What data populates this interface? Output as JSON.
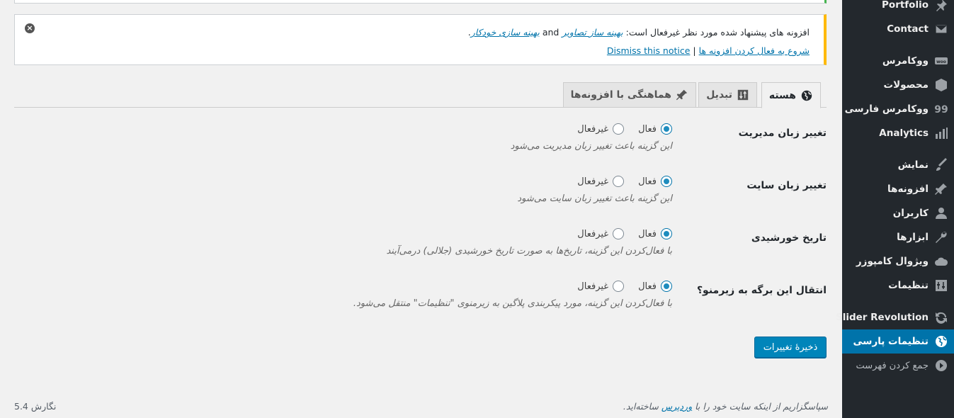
{
  "sidebar": {
    "items": [
      {
        "label": "Portfolio",
        "icon": "pin-icon"
      },
      {
        "label": "Contact",
        "icon": "mail-icon"
      },
      {
        "label": "ووکامرس",
        "icon": "woo-icon"
      },
      {
        "label": "محصولات",
        "icon": "box-icon"
      },
      {
        "label": "ووکامرس فارسی",
        "icon": "quote-icon"
      },
      {
        "label": "Analytics",
        "icon": "bar-chart-icon"
      },
      {
        "label": "نمایش",
        "icon": "brush-icon"
      },
      {
        "label": "افزونه‌ها",
        "icon": "plug-icon"
      },
      {
        "label": "کاربران",
        "icon": "user-icon"
      },
      {
        "label": "ابزارها",
        "icon": "wrench-icon"
      },
      {
        "label": "ویژوال کامپوزر",
        "icon": "cloud-icon"
      },
      {
        "label": "تنظیمات",
        "icon": "sliders-icon"
      },
      {
        "label": "Slider Revolution",
        "icon": "refresh-icon"
      },
      {
        "label": "تنظیمات پارسی",
        "icon": "globe-icon"
      },
      {
        "label": "جمع کردن فهرست",
        "icon": "collapse-icon"
      }
    ]
  },
  "notice": {
    "text_before": "افزونه های پیشنهاد شده مورد نظر غیرفعال است: ",
    "link1": "بهینه ساز تصاویر",
    "and": " and ",
    "link2": "بهینه سازی خودکار",
    "period": ".",
    "activate_link": "شروع به فعال کردن افزونه ها",
    "separator": " | ",
    "dismiss_link": "Dismiss this notice"
  },
  "tabs": [
    {
      "label": "هسته",
      "icon": "globe-icon"
    },
    {
      "label": "تبدیل",
      "icon": "sort-icon"
    },
    {
      "label": "هماهنگی با افزونه‌ها",
      "icon": "plug-icon"
    }
  ],
  "settings": [
    {
      "label": "تغییر زبان مدیریت",
      "on": "فعال",
      "off": "غیرفعال",
      "desc": "این گزینه باعث تغییر زبان مدیریت می‌شود"
    },
    {
      "label": "تغییر زبان سایت",
      "on": "فعال",
      "off": "غیرفعال",
      "desc": "این گزینه باعث تغییر زبان سایت می‌شود"
    },
    {
      "label": "تاریخ خورشیدی",
      "on": "فعال",
      "off": "غیرفعال",
      "desc": "با فعال‌کردن این گزینه، تاریخ‌ها به صورت تاریخ خورشیدی (جلالی) درمی‌آیند"
    },
    {
      "label": "انتقال این برگه به زیرمنو؟",
      "on": "فعال",
      "off": "غیرفعال",
      "desc": "با فعال‌کردن این گزینه، مورد پیکربندی پلاگین به زیرمنوی \"تنظیمات\" منتقل می‌شود."
    }
  ],
  "save_label": "ذخیرهٔ تغییرات",
  "footer": {
    "thanks_before": "سپاسگزاریم از اینکه سایت خود را با ",
    "wp_link": "وردپرس",
    "thanks_after": " ساخته‌اید.",
    "version": "نگارش 5.4"
  },
  "colors": {
    "accent": "#0073aa",
    "sidebar": "#23282d",
    "notice_border": "#ffb900"
  }
}
